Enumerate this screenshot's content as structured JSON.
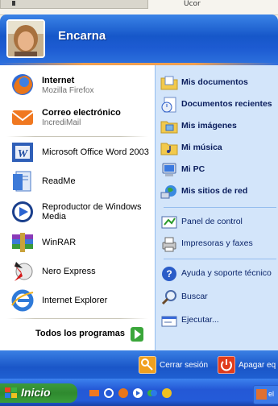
{
  "background": {
    "partial_text": "Ucor"
  },
  "user": {
    "name": "Encarna"
  },
  "pinned": [
    {
      "title": "Internet",
      "subtitle": "Mozilla Firefox",
      "icon": "firefox-icon"
    },
    {
      "title": "Correo electrónico",
      "subtitle": "IncrediMail",
      "icon": "mail-icon"
    }
  ],
  "recent": [
    {
      "title": "Microsoft Office Word 2003",
      "icon": "word-icon"
    },
    {
      "title": "ReadMe",
      "icon": "document-icon"
    },
    {
      "title": "Reproductor de Windows",
      "title2": "Media",
      "icon": "media-player-icon"
    },
    {
      "title": "WinRAR",
      "icon": "winrar-icon"
    },
    {
      "title": "Nero Express",
      "icon": "nero-icon"
    },
    {
      "title": "Internet Explorer",
      "icon": "ie-icon"
    }
  ],
  "all_programs": {
    "label": "Todos los programas"
  },
  "right": [
    {
      "label": "Mis documentos",
      "bold": true,
      "icon": "folder-documents-icon"
    },
    {
      "label": "Documentos recientes",
      "bold": true,
      "icon": "recent-documents-icon"
    },
    {
      "label": "Mis imágenes",
      "bold": true,
      "icon": "folder-pictures-icon"
    },
    {
      "label": "Mi música",
      "bold": true,
      "icon": "folder-music-icon"
    },
    {
      "label": "Mi PC",
      "bold": true,
      "icon": "computer-icon"
    },
    {
      "label": "Mis sitios de red",
      "bold": true,
      "icon": "network-icon"
    },
    {
      "label": "Panel de control",
      "bold": false,
      "icon": "control-panel-icon"
    },
    {
      "label": "Impresoras y faxes",
      "bold": false,
      "icon": "printer-icon"
    },
    {
      "label": "Ayuda y soporte técnico",
      "bold": false,
      "icon": "help-icon"
    },
    {
      "label": "Buscar",
      "bold": false,
      "icon": "search-icon"
    },
    {
      "label": "Ejecutar...",
      "bold": false,
      "icon": "run-icon"
    }
  ],
  "footer": {
    "logoff": "Cerrar sesión",
    "shutdown": "Apagar eq"
  },
  "taskbar": {
    "start": "Inicio",
    "task_label": "el"
  },
  "colors": {
    "header_blue": "#1657c9",
    "start_green": "#3c9a3c",
    "right_panel": "#d3e5fa",
    "logoff_orange": "#f0a020",
    "shutdown_red": "#e03c1c"
  }
}
